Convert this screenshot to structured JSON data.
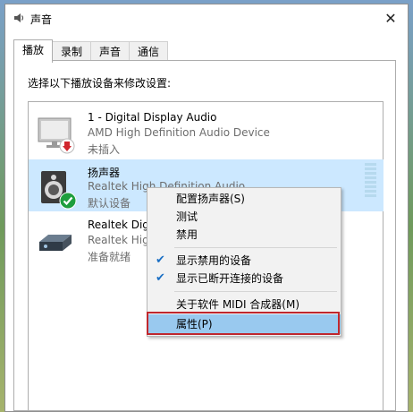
{
  "window": {
    "title": "声音",
    "icon": "speaker-icon",
    "close": "✕"
  },
  "tabs": [
    {
      "label": "播放",
      "active": true
    },
    {
      "label": "录制",
      "active": false
    },
    {
      "label": "声音",
      "active": false
    },
    {
      "label": "通信",
      "active": false
    }
  ],
  "instruction": "选择以下播放设备来修改设置:",
  "devices": [
    {
      "name": "1 - Digital Display Audio",
      "description": "AMD High Definition Audio Device",
      "status": "未插入",
      "icon": "monitor-icon",
      "badge": "unplugged-arrow-icon"
    },
    {
      "name": "扬声器",
      "description": "Realtek High Definition Audio",
      "status": "默认设备",
      "icon": "speaker-icon",
      "badge": "default-check-icon",
      "selected": true
    },
    {
      "name": "Realtek Digit",
      "description": "Realtek High",
      "status": "准备就绪",
      "icon": "spdif-icon"
    }
  ],
  "context_menu": {
    "items": [
      {
        "label": "配置扬声器(S)",
        "checked": false
      },
      {
        "label": "测试",
        "checked": false
      },
      {
        "label": "禁用",
        "checked": false
      },
      {
        "label": "显示禁用的设备",
        "checked": true
      },
      {
        "label": "显示已断开连接的设备",
        "checked": true
      },
      {
        "label": "关于软件 MIDI 合成器(M)",
        "checked": false
      },
      {
        "label": "属性(P)",
        "checked": false,
        "highlighted": true
      }
    ],
    "check_glyph": "✔"
  }
}
